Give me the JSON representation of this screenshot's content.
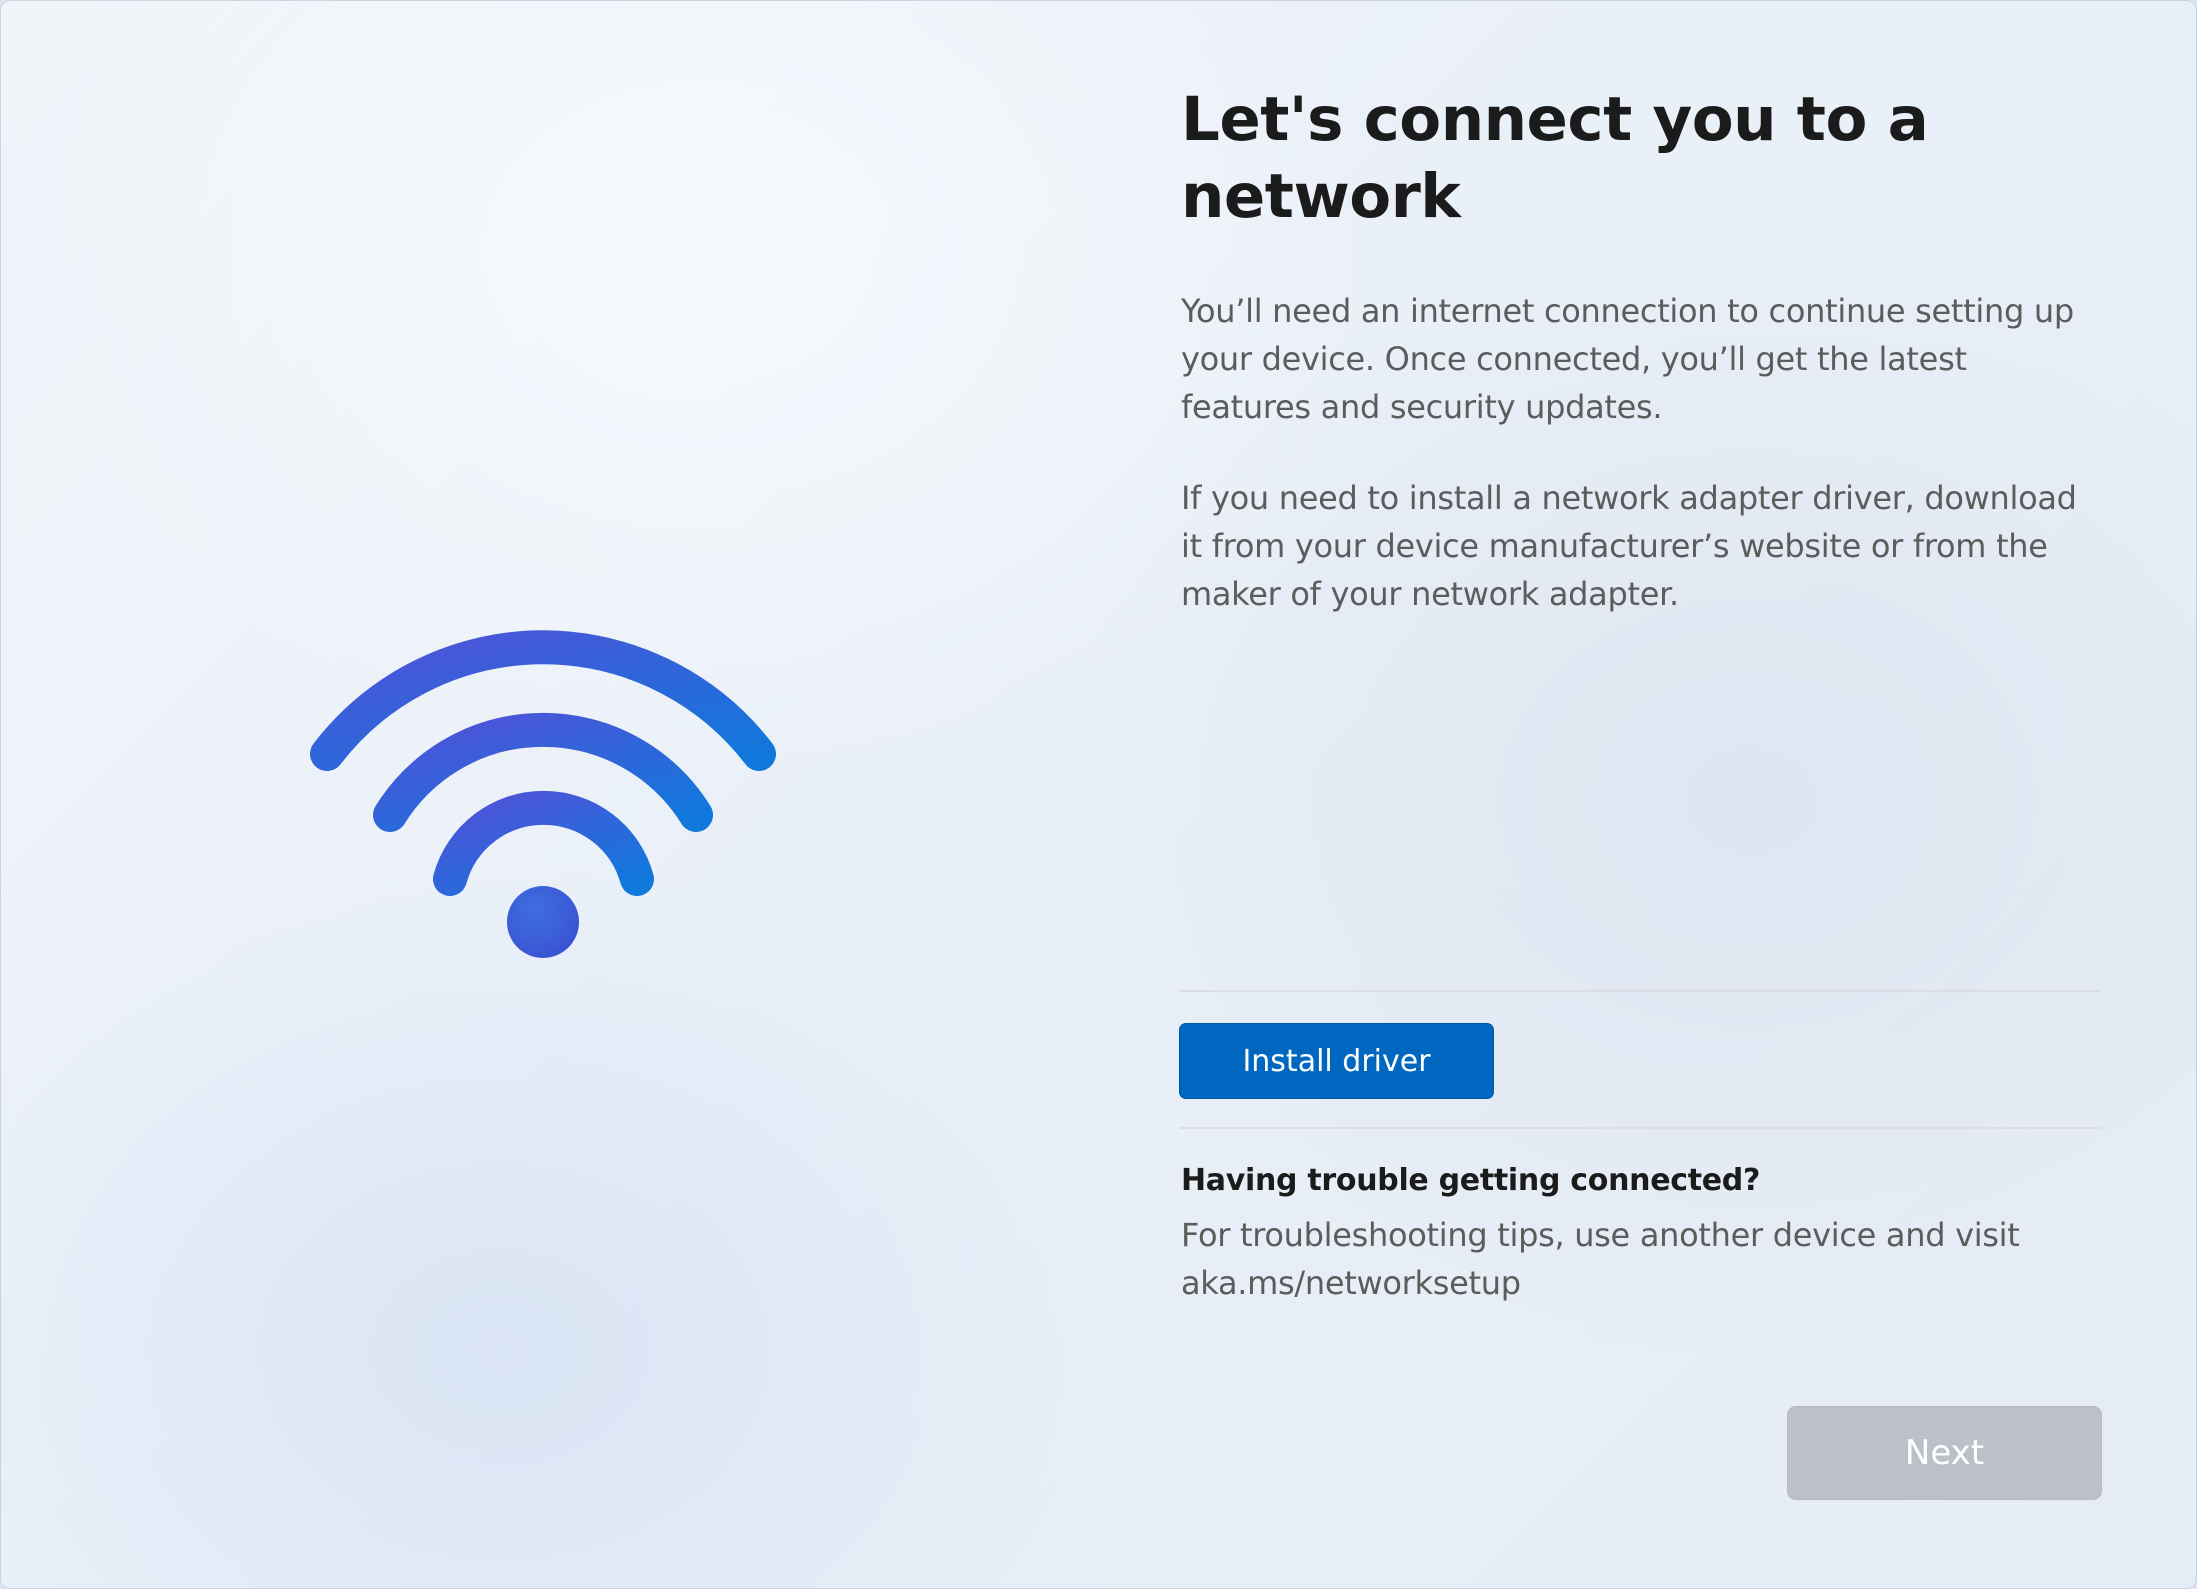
{
  "page": {
    "title": "Let's connect you to a network",
    "paragraph1": "You’ll need an internet connection to continue setting up your device. Once connected, you’ll get the latest features and security updates.",
    "paragraph2": "If you need to install a network adapter driver, download it from your device manufacturer’s website or from the maker of your network adapter."
  },
  "actions": {
    "install_driver_label": "Install driver",
    "next_label": "Next",
    "next_enabled": false
  },
  "help": {
    "heading": "Having trouble getting connected?",
    "text": "For troubleshooting tips, use another device and visit aka.ms/networksetup"
  },
  "illustration": {
    "icon": "wifi-icon",
    "gradient_start": "#4f52d8",
    "gradient_end": "#1178dc"
  },
  "colors": {
    "primary_button": "#0067c0",
    "disabled_button": "#bcc0c8",
    "heading_text": "#1b1b1b",
    "body_text": "#5c5c5c"
  }
}
